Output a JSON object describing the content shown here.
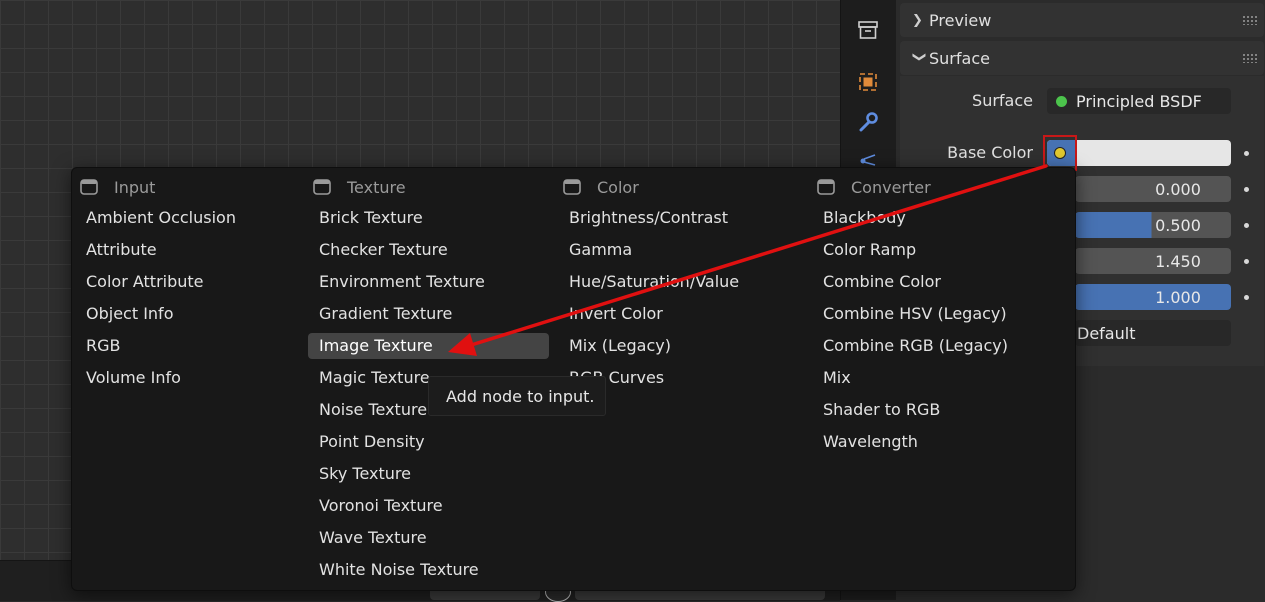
{
  "properties": {
    "preview_header": "Preview",
    "surface_header": "Surface",
    "surface_label": "Surface",
    "surface_value": "Principled BSDF",
    "base_color_label": "Base Color",
    "value_rows": [
      "0.000",
      "0.500",
      "1.450",
      "1.000"
    ],
    "default_value": "Default",
    "socket_color": "#e0c830",
    "bsdf_dot_color": "#4cc44c",
    "accent_blue": "#4772b3"
  },
  "menu": {
    "columns": [
      {
        "header": "Input",
        "items": [
          "Ambient Occlusion",
          "Attribute",
          "Color Attribute",
          "Object Info",
          "RGB",
          "Volume Info"
        ]
      },
      {
        "header": "Texture",
        "items": [
          "Brick Texture",
          "Checker Texture",
          "Environment Texture",
          "Gradient Texture",
          "Image Texture",
          "Magic Texture",
          "Noise Texture",
          "Point Density",
          "Sky Texture",
          "Voronoi Texture",
          "Wave Texture",
          "White Noise Texture"
        ]
      },
      {
        "header": "Color",
        "items": [
          "Brightness/Contrast",
          "Gamma",
          "Hue/Saturation/Value",
          "Invert Color",
          "Mix (Legacy)",
          "RGB Curves"
        ]
      },
      {
        "header": "Converter",
        "items": [
          "Blackbody",
          "Color Ramp",
          "Combine Color",
          "Combine HSV (Legacy)",
          "Combine RGB (Legacy)",
          "Mix",
          "Shader to RGB",
          "Wavelength"
        ]
      }
    ],
    "active_item": "Image Texture",
    "tooltip": "Add node to input."
  },
  "annotation": {
    "arrow_color": "#e01010"
  },
  "icons": [
    "archive-icon",
    "object-icon",
    "wrench-icon",
    "particles-icon",
    "node-group-icon"
  ]
}
